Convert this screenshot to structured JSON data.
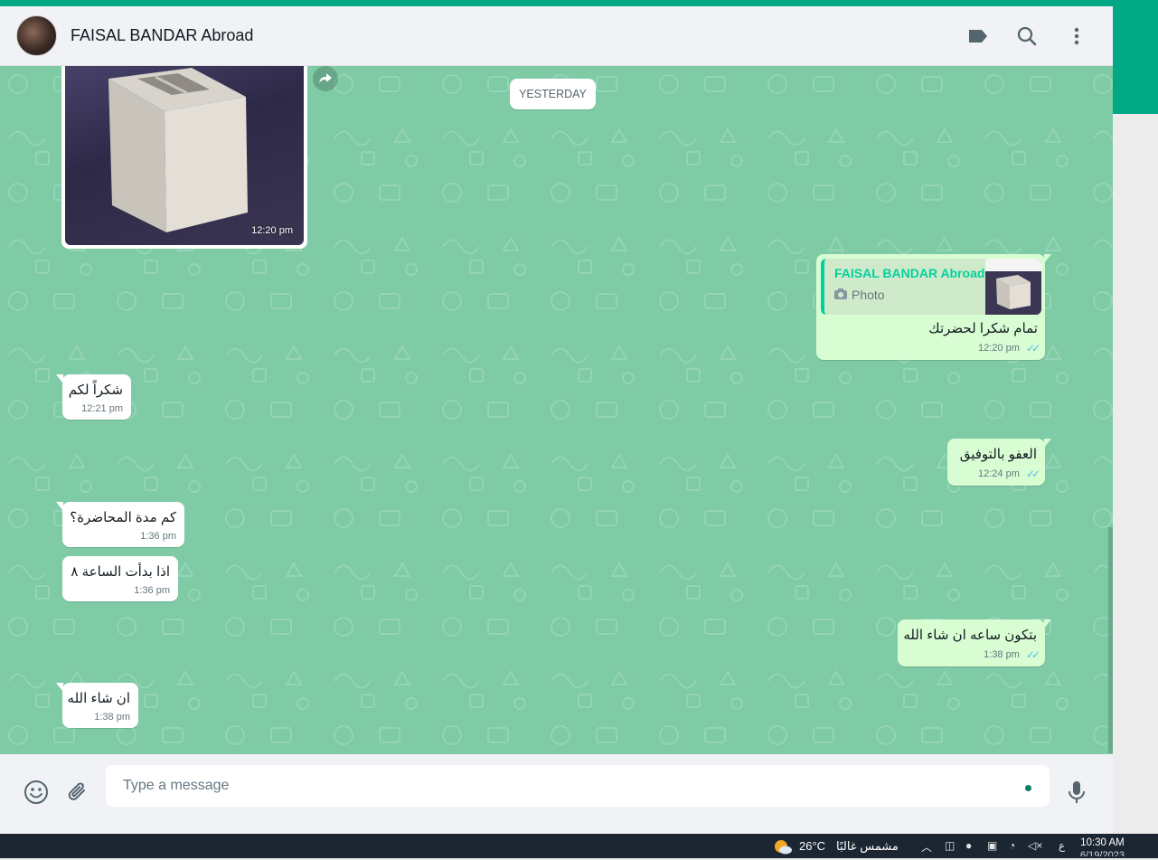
{
  "header": {
    "contact_name": "FAISAL BANDAR Abroad"
  },
  "chat": {
    "date_separator": "YESTERDAY",
    "photo_message": {
      "time": "12:20 pm"
    },
    "messages": [
      {
        "direction": "outgoing",
        "text": "تمام شكرا لحضرتك",
        "time": "12:20 pm",
        "status_icon": "double-check-icon",
        "reply_to": {
          "name": "FAISAL BANDAR Abroad",
          "kind": "Photo"
        }
      },
      {
        "direction": "incoming",
        "text": "شكراً لكم",
        "time": "12:21 pm"
      },
      {
        "direction": "outgoing",
        "text": "العفو بالتوفيق",
        "time": "12:24 pm",
        "status_icon": "double-check-icon"
      },
      {
        "direction": "incoming",
        "text": "كم مدة المحاضرة؟",
        "time": "1:36 pm"
      },
      {
        "direction": "incoming",
        "text": "اذا بدأت الساعة ٨",
        "time": "1:36 pm"
      },
      {
        "direction": "outgoing",
        "text": "بتكون ساعه ان شاء الله",
        "time": "1:38 pm",
        "status_icon": "double-check-icon"
      },
      {
        "direction": "incoming",
        "text": "ان شاء الله",
        "time": "1:38 pm"
      }
    ]
  },
  "composer": {
    "placeholder": "Type a message",
    "value": ""
  },
  "taskbar": {
    "temperature": "26°C",
    "weather_text": "مشمس غالبًا",
    "time": "10:30 AM",
    "date": "6/19/2023",
    "lang": "ع"
  },
  "colors": {
    "accent": "#00a884",
    "chat_background": "#7ecba6",
    "outgoing_bubble": "#d9fdd3",
    "incoming_bubble": "#ffffff",
    "read_ticks": "#53bdeb"
  }
}
